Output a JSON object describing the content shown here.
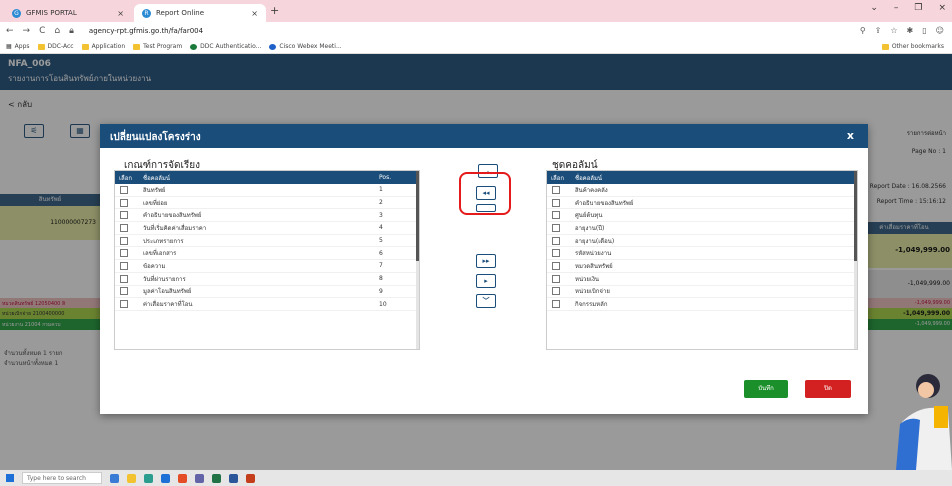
{
  "browser": {
    "tabs": [
      {
        "label": "GFMIS PORTAL"
      },
      {
        "label": "Report Online"
      }
    ],
    "url": "agency-rpt.gfmis.go.th/fa/far004",
    "bookmarks": [
      "Apps",
      "DDC-Acc",
      "Application",
      "Test Program",
      "DDC Authenticatio...",
      "Cisco Webex Meeti..."
    ],
    "other_bookmarks": "Other bookmarks"
  },
  "app": {
    "code": "NFA_006",
    "subtitle": "รายงานการโอนสินทรัพย์ภายในหน่วยงาน",
    "back": "< กลับ",
    "per_page_label": "รายการต่อหน้า",
    "page_no": "Page No : 1",
    "report_date": "Report Date : 16.08.2566",
    "report_time": "Report Time : 15:16:12",
    "bg_col_asset": "สินทรัพย์",
    "bg_col_right": "ค่าเสื่อมราคาที่โอน",
    "bg_row_id": "110000007273",
    "bg_value": "-1,049,999.00",
    "bg_grey_value": "-1,049,999.00",
    "bg_pink_left": "หมวดสินทรัพย์ 12050400 สิ",
    "bg_pink_right": "-1,049,999.00",
    "bg_lgreen_left": "หน่วยเบิกจ่าย 2100400000",
    "bg_lgreen_right": "-1,049,999.00",
    "bg_dgreen_left": "หน่วยงาน 21004 กรมควบ",
    "bg_dgreen_right": "-1,049,999.00",
    "bg_note1": "จำนวนทั้งหมด 1 รายก",
    "bg_note2": "จำนวนหน้าทั้งหมด 1"
  },
  "modal": {
    "title": "เปลี่ยนแปลงโครงร่าง",
    "close_icon_label": "x",
    "left_panel_title": "เกณฑ์การจัดเรียง",
    "right_panel_title": "ชุดคอลัมน์",
    "left_headers": {
      "select": "เลือก",
      "name": "ชื่อคอลัมน์",
      "pos": "Pos."
    },
    "right_headers": {
      "select": "เลือก",
      "name": "ชื่อคอลัมน์"
    },
    "left_rows": [
      {
        "name": "สินทรัพย์",
        "pos": "1"
      },
      {
        "name": "เลขที่ย่อย",
        "pos": "2"
      },
      {
        "name": "คำอธิบายของสินทรัพย์",
        "pos": "3"
      },
      {
        "name": "วันที่เริ่มคิดค่าเสื่อมราคา",
        "pos": "4"
      },
      {
        "name": "ประเภทรายการ",
        "pos": "5"
      },
      {
        "name": "เลขที่เอกสาร",
        "pos": "6"
      },
      {
        "name": "ข้อความ",
        "pos": "7"
      },
      {
        "name": "วันที่ผ่านรายการ",
        "pos": "8"
      },
      {
        "name": "มูลค่าโอนสินทรัพย์",
        "pos": "9"
      },
      {
        "name": "ค่าเสื่อมราคาที่โอน",
        "pos": "10"
      }
    ],
    "right_rows": [
      {
        "name": "สินค้าคงคลัง"
      },
      {
        "name": "คำอธิบายของสินทรัพย์"
      },
      {
        "name": "ศูนย์ต้นทุน"
      },
      {
        "name": "อายุงาน(ปี)"
      },
      {
        "name": "อายุงาน(เดือน)"
      },
      {
        "name": "รหัสหน่วยงาน"
      },
      {
        "name": "หมวดสินทรัพย์"
      },
      {
        "name": "หน่วยเงิน"
      },
      {
        "name": "หน่วยเบิกจ่าย"
      },
      {
        "name": "กิจกรรมหลัก"
      }
    ],
    "buttons": {
      "up": "︿",
      "move_all_left": "◂◂",
      "move_left": "◂",
      "move_all_right": "▸▸",
      "move_right": "▸",
      "down": "﹀",
      "save": "บันทึก",
      "close": "ปิด"
    }
  },
  "taskbar": {
    "search_placeholder": "Type here to search"
  },
  "colors": {
    "header_blue": "#1a4d7a",
    "save_green": "#1a8f2a",
    "close_red": "#d32020",
    "highlight_red": "#e51a1a"
  }
}
